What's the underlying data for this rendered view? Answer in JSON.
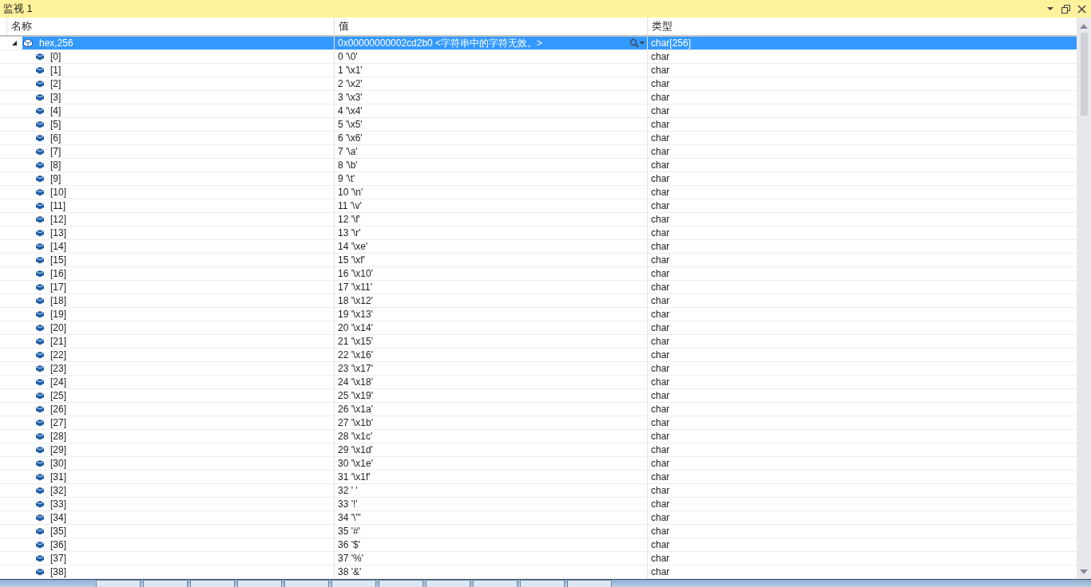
{
  "window": {
    "title": "监视 1"
  },
  "columns": [
    "名称",
    "值",
    "类型"
  ],
  "rows": [
    {
      "name": "hex,256",
      "value": "0x00000000002cd2b0  <字符串中的字符无效。>",
      "type": "char[256]",
      "expanded": true,
      "selected": true,
      "children": [
        {
          "name": "[0]",
          "value": "0 '\\0'",
          "type": "char",
          "selected": false
        },
        {
          "name": "[1]",
          "value": "1 '\\x1'",
          "type": "char",
          "selected": false
        },
        {
          "name": "[2]",
          "value": "2 '\\x2'",
          "type": "char",
          "selected": false
        },
        {
          "name": "[3]",
          "value": "3 '\\x3'",
          "type": "char",
          "selected": false
        },
        {
          "name": "[4]",
          "value": "4 '\\x4'",
          "type": "char",
          "selected": false
        },
        {
          "name": "[5]",
          "value": "5 '\\x5'",
          "type": "char",
          "selected": false
        },
        {
          "name": "[6]",
          "value": "6 '\\x6'",
          "type": "char",
          "selected": false
        },
        {
          "name": "[7]",
          "value": "7 '\\a'",
          "type": "char",
          "selected": false
        },
        {
          "name": "[8]",
          "value": "8 '\\b'",
          "type": "char",
          "selected": false
        },
        {
          "name": "[9]",
          "value": "9 '\\t'",
          "type": "char",
          "selected": false
        },
        {
          "name": "[10]",
          "value": "10 '\\n'",
          "type": "char",
          "selected": false
        },
        {
          "name": "[11]",
          "value": "11 '\\v'",
          "type": "char",
          "selected": false
        },
        {
          "name": "[12]",
          "value": "12 '\\f'",
          "type": "char",
          "selected": false
        },
        {
          "name": "[13]",
          "value": "13 '\\r'",
          "type": "char",
          "selected": false
        },
        {
          "name": "[14]",
          "value": "14 '\\xe'",
          "type": "char",
          "selected": false
        },
        {
          "name": "[15]",
          "value": "15 '\\xf'",
          "type": "char",
          "selected": false
        },
        {
          "name": "[16]",
          "value": "16 '\\x10'",
          "type": "char",
          "selected": false
        },
        {
          "name": "[17]",
          "value": "17 '\\x11'",
          "type": "char",
          "selected": false
        },
        {
          "name": "[18]",
          "value": "18 '\\x12'",
          "type": "char",
          "selected": false
        },
        {
          "name": "[19]",
          "value": "19 '\\x13'",
          "type": "char",
          "selected": false
        },
        {
          "name": "[20]",
          "value": "20 '\\x14'",
          "type": "char",
          "selected": false
        },
        {
          "name": "[21]",
          "value": "21 '\\x15'",
          "type": "char",
          "selected": false
        },
        {
          "name": "[22]",
          "value": "22 '\\x16'",
          "type": "char",
          "selected": false
        },
        {
          "name": "[23]",
          "value": "23 '\\x17'",
          "type": "char",
          "selected": false
        },
        {
          "name": "[24]",
          "value": "24 '\\x18'",
          "type": "char",
          "selected": false
        },
        {
          "name": "[25]",
          "value": "25 '\\x19'",
          "type": "char",
          "selected": false
        },
        {
          "name": "[26]",
          "value": "26 '\\x1a'",
          "type": "char",
          "selected": false
        },
        {
          "name": "[27]",
          "value": "27 '\\x1b'",
          "type": "char",
          "selected": false
        },
        {
          "name": "[28]",
          "value": "28 '\\x1c'",
          "type": "char",
          "selected": false
        },
        {
          "name": "[29]",
          "value": "29 '\\x1d'",
          "type": "char",
          "selected": false
        },
        {
          "name": "[30]",
          "value": "30 '\\x1e'",
          "type": "char",
          "selected": false
        },
        {
          "name": "[31]",
          "value": "31 '\\x1f'",
          "type": "char",
          "selected": false
        },
        {
          "name": "[32]",
          "value": "32 ' '",
          "type": "char",
          "selected": false
        },
        {
          "name": "[33]",
          "value": "33 '!'",
          "type": "char",
          "selected": false
        },
        {
          "name": "[34]",
          "value": "34 '\\\"'",
          "type": "char",
          "selected": false
        },
        {
          "name": "[35]",
          "value": "35 '#'",
          "type": "char",
          "selected": false
        },
        {
          "name": "[36]",
          "value": "36 '$'",
          "type": "char",
          "selected": false
        },
        {
          "name": "[37]",
          "value": "37 '%'",
          "type": "char",
          "selected": false
        },
        {
          "name": "[38]",
          "value": "38 '&'",
          "type": "char",
          "selected": false
        }
      ]
    }
  ]
}
